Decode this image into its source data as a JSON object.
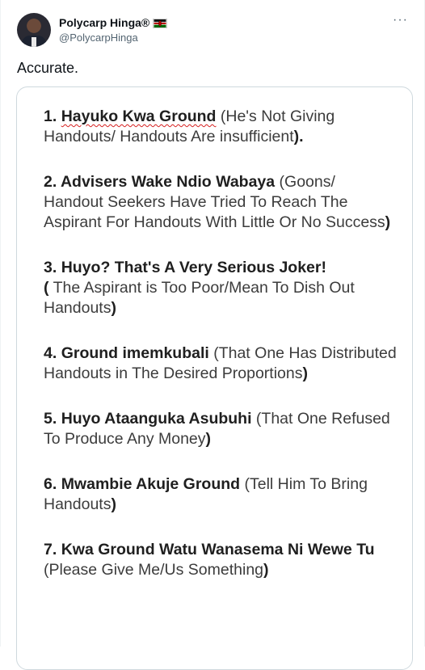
{
  "author": {
    "name": "Polycarp Hinga®",
    "handle": "@PolycarpHinga",
    "flag_icon": "kenya-flag-icon"
  },
  "tweet": {
    "text": "Accurate.",
    "more_icon": "more-options-icon",
    "more_label": "···"
  },
  "items": [
    {
      "num": "1. ",
      "bold": "Hayuko Kwa Ground",
      "rest_bold_end": "",
      "text": " (He's Not Giving Handouts/ Handouts Are insufficient",
      "close": ")."
    },
    {
      "num": "2. ",
      "bold": "Advisers Wake Ndio Wabaya",
      "text": " (Goons/ Handout Seekers Have Tried To Reach The Aspirant For Handouts With Little Or No Success",
      "close": ")"
    },
    {
      "num": "3. ",
      "bold": "Huyo? That's A Very Serious Joker!",
      "text": " (",
      "text2": " The Aspirant is Too Poor/Mean To Dish Out Handouts",
      "close": ")"
    },
    {
      "num": "4. ",
      "bold": "Ground imemkubali",
      "text": " (That One Has Distributed Handouts in The Desired Proportions",
      "close": ")"
    },
    {
      "num": "5. ",
      "bold": "Huyo Ataanguka Asubuhi",
      "text": " (That One Refused To Produce Any Money",
      "close": ")"
    },
    {
      "num": "6. ",
      "bold": "Mwambie Akuje Ground",
      "text": " (Tell Him To Bring Handouts",
      "close": ")"
    },
    {
      "num": "7. ",
      "bold": "Kwa Ground Watu Wanasema Ni Wewe Tu",
      "text": " (Please Give Me/Us Something",
      "close": ")"
    }
  ]
}
